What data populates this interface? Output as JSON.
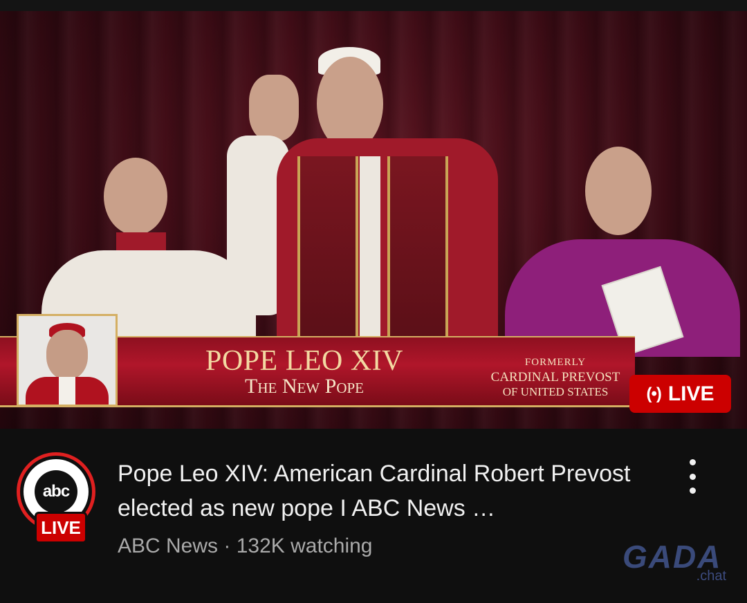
{
  "video": {
    "lower_third": {
      "title": "POPE LEO XIV",
      "subtitle": "The New Pope",
      "right_line1": "FORMERLY",
      "right_line2": "CARDINAL PREVOST",
      "right_line3": "OF UNITED STATES"
    },
    "live_pill": {
      "icon": "broadcast-icon",
      "icon_glyph": "(•)",
      "label": "LIVE"
    }
  },
  "channel": {
    "logo_text": "abc",
    "live_badge": "LIVE"
  },
  "video_title": "Pope Leo XIV: American Cardinal Robert Prevost elected as new pope I ABC News …",
  "meta": "ABC News · 132K watching",
  "watermark": {
    "main": "GADA",
    "sub": ".chat"
  },
  "colors": {
    "live_red": "#cc0000",
    "background": "#0f0f0f",
    "gold": "#d4af63"
  }
}
